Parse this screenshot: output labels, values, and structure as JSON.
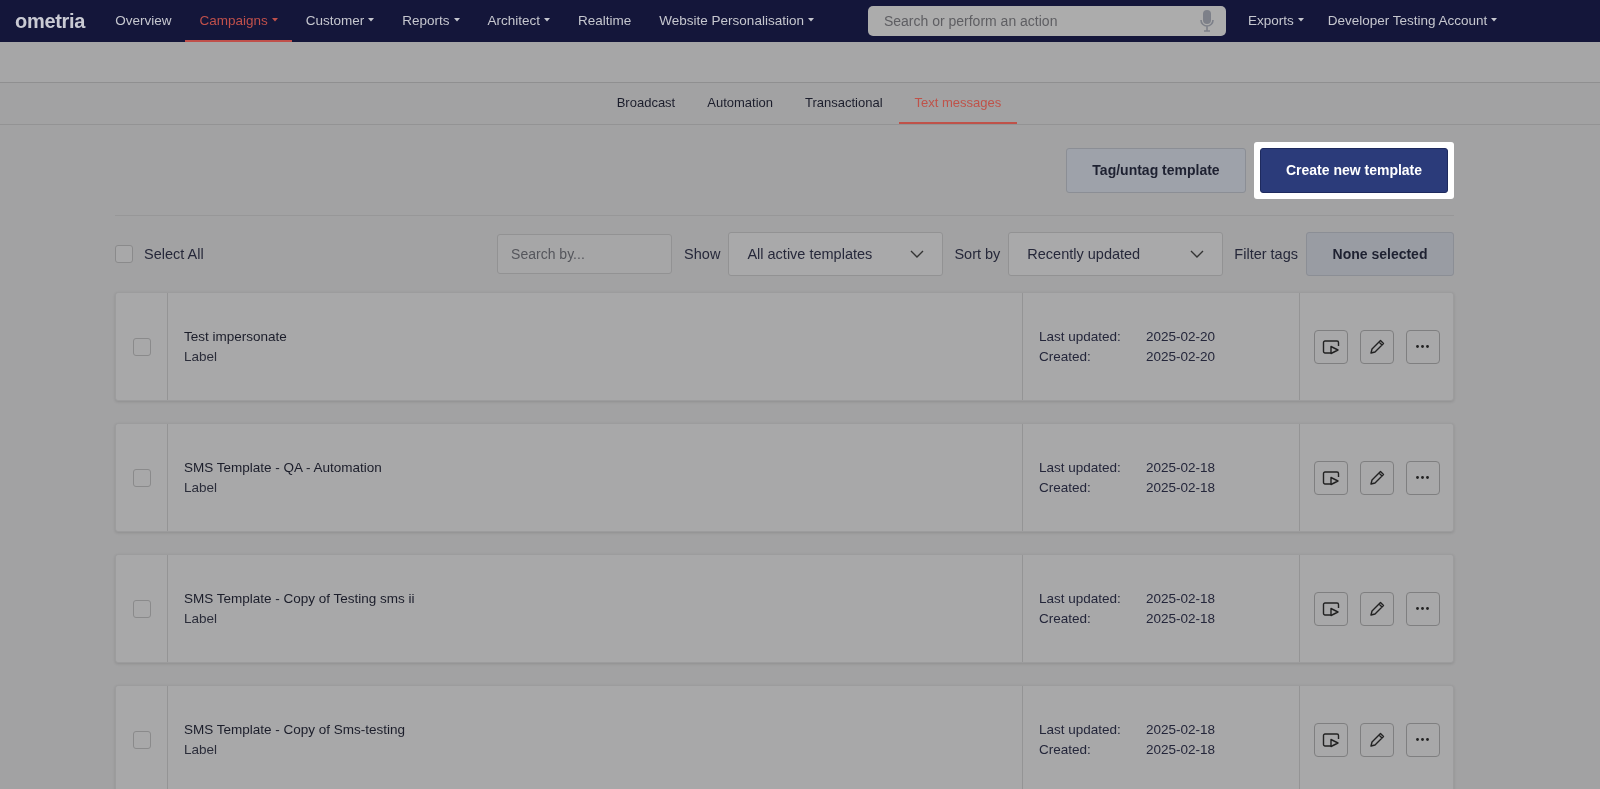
{
  "nav": {
    "logo": "ometria",
    "items": [
      {
        "label": "Overview",
        "selected": false,
        "dropdown": false
      },
      {
        "label": "Campaigns",
        "selected": true,
        "dropdown": true
      },
      {
        "label": "Customer",
        "selected": false,
        "dropdown": true
      },
      {
        "label": "Reports",
        "selected": false,
        "dropdown": true
      },
      {
        "label": "Architect",
        "selected": false,
        "dropdown": true
      },
      {
        "label": "Realtime",
        "selected": false,
        "dropdown": false
      },
      {
        "label": "Website Personalisation",
        "selected": false,
        "dropdown": true
      }
    ],
    "search": {
      "placeholder": "Search or perform an action"
    },
    "right_items": [
      {
        "label": "Exports",
        "dropdown": true
      },
      {
        "label": "Developer Testing Account",
        "dropdown": true
      }
    ]
  },
  "tabs": [
    {
      "label": "Broadcast",
      "selected": false
    },
    {
      "label": "Automation",
      "selected": false
    },
    {
      "label": "Transactional",
      "selected": false
    },
    {
      "label": "Text messages",
      "selected": true
    }
  ],
  "actions": [
    {
      "label": "Tag/untag template",
      "kind": "secondary",
      "highlighted": false
    },
    {
      "label": "Create new template",
      "kind": "primary",
      "highlighted": true
    }
  ],
  "filters": {
    "select_all": {
      "label": "Select All",
      "checked": false
    },
    "search": {
      "placeholder": "Search by..."
    },
    "show": {
      "label": "Show",
      "value": "All active templates"
    },
    "sort": {
      "label": "Sort by",
      "value": "Recently updated"
    },
    "tags": {
      "label": "Filter tags",
      "value": "None selected"
    }
  },
  "rows": [
    {
      "title": "Test impersonate",
      "label": "Label",
      "updated_label": "Last updated:",
      "updated": "2025-02-20",
      "created_label": "Created:",
      "created": "2025-02-20",
      "checked": false
    },
    {
      "title": "SMS Template - QA - Automation",
      "label": "Label",
      "updated_label": "Last updated:",
      "updated": "2025-02-18",
      "created_label": "Created:",
      "created": "2025-02-18",
      "checked": false
    },
    {
      "title": "SMS Template - Copy of Testing sms ii",
      "label": "Label",
      "updated_label": "Last updated:",
      "updated": "2025-02-18",
      "created_label": "Created:",
      "created": "2025-02-18",
      "checked": false
    },
    {
      "title": "SMS Template - Copy of Sms-testing",
      "label": "Label",
      "updated_label": "Last updated:",
      "updated": "2025-02-18",
      "created_label": "Created:",
      "created": "2025-02-18",
      "checked": false
    }
  ]
}
